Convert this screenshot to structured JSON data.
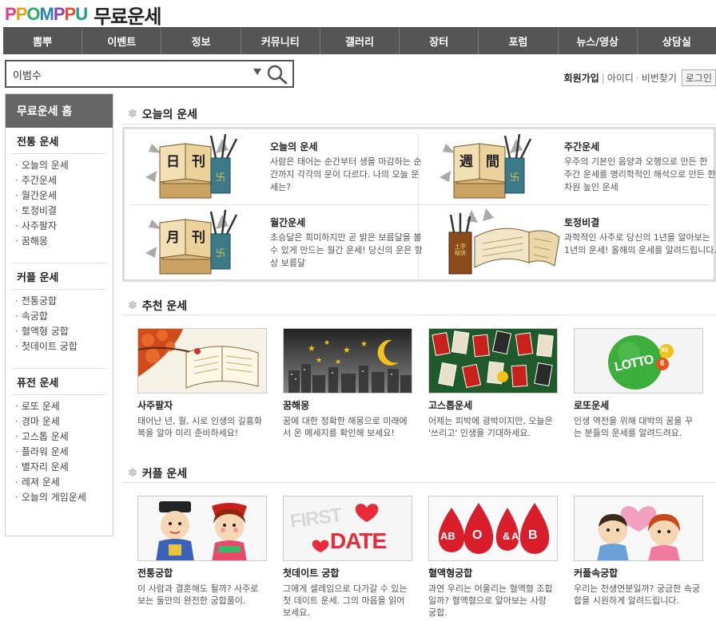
{
  "header": {
    "logo_text": "PPOMPPU",
    "title": "무료운세"
  },
  "nav": {
    "items": [
      "뽐뿌",
      "이벤트",
      "정보",
      "커뮤니티",
      "갤러리",
      "장터",
      "포럼",
      "뉴스/영상",
      "상담실"
    ]
  },
  "search": {
    "value": "이범수"
  },
  "member": {
    "join": "회원가입",
    "id": "아이디",
    "password": "비번찾기",
    "login": "로그인"
  },
  "sidebar": {
    "home": "무료운세 홈",
    "groups": [
      {
        "title": "전통 운세",
        "items": [
          "오늘의 운세",
          "주간운세",
          "월간운세",
          "토정비결",
          "사주팔자",
          "꿈해몽"
        ]
      },
      {
        "title": "커플 운세",
        "items": [
          "전통궁합",
          "속궁합",
          "혈액형 궁합",
          "첫데이트 궁합"
        ]
      },
      {
        "title": "퓨전 운세",
        "items": [
          "로또 운세",
          "경마 운세",
          "고스톱 운세",
          "플라워 운세",
          "별자리 운세",
          "레져 운세",
          "오늘의 게임운세"
        ]
      }
    ]
  },
  "today": {
    "section_title": "오늘의 운세",
    "cells": [
      {
        "title": "오늘의 운세",
        "desc": "사람은 태어는 순간부터 생을 마감하는 순간까지 각각의 운이 다르다. 나의 오늘 운세는?",
        "glyphs": [
          "日",
          "刊"
        ]
      },
      {
        "title": "주간운세",
        "desc": "우주의 기본인 음양과 오행으로 만든 한 주간 운세를 명리학적인 해석으로 만든 한 차원 높인 운세",
        "glyphs": [
          "週",
          "間"
        ]
      },
      {
        "title": "월간운세",
        "desc": "초승달은 희미하지만 곧 밝은 보름달을 볼 수 있게 만드는 월간 운세! 당신의 운은 항상 보름달",
        "glyphs": [
          "月",
          "刊"
        ]
      },
      {
        "title": "토정비결",
        "desc": "과학적인 사주로 당신의 1년을 알아보는 1년의 운세! 올해의 운세를 알려드립니다.",
        "glyphs": [
          "土亭秘訣"
        ]
      }
    ]
  },
  "recommend": {
    "section_title": "추천 운세",
    "cards": [
      {
        "title": "사주팔자",
        "desc": "태어난 년, 월, 시로 인생의 길흉화복을 알아 미리 준비하세요!"
      },
      {
        "title": "꿈해몽",
        "desc": "꿈에 대한 정확한 해몽으로 미래에서 온 메세지를 확인해 보세요!"
      },
      {
        "title": "고스톱운세",
        "desc": "어제는 피박에 광박이지만, 오늘은 '쓰리고' 인생을 기대하세요."
      },
      {
        "title": "로또운세",
        "desc": "인생 역전을 위해 대박의 꿈을 꾸는 분들의 운세를 알려드려요.",
        "img_text": "LOTTO",
        "ball1": "45",
        "ball2": "6"
      }
    ]
  },
  "couple": {
    "section_title": "커플 운세",
    "cards": [
      {
        "title": "전통궁합",
        "desc": "이 사람과 결혼해도 될까? 사주로 보는 둘만의 완전한 궁합풀이."
      },
      {
        "title": "첫데이트 궁합",
        "desc": "그에게 셀레임으로 다가갈 수 있는 첫 데이트 운세. 그의 마음을 읽어보세요.",
        "img_line1": "FIRST",
        "img_line2": "DATE"
      },
      {
        "title": "혈액형궁합",
        "desc": "과연 우리는 어울리는 혈액형 조합일까? 혈액형으로 알아보는 사랑 궁합.",
        "drops": [
          "AB",
          "O",
          "&",
          "A",
          "B"
        ]
      },
      {
        "title": "커플속궁합",
        "desc": "우리는 천생연분일까? 궁금한 속궁합을 시원하게 알려드립니다."
      }
    ]
  },
  "colors": {
    "nav_bg": "#555555",
    "sidebar_head": "#666666",
    "logo": [
      "#e8348a",
      "#f39c12",
      "#27ae60",
      "#2980b9",
      "#8e44ad",
      "#e74c3c",
      "#16a085"
    ]
  }
}
